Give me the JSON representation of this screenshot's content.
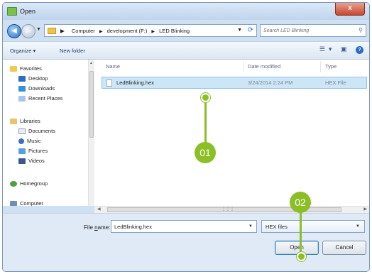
{
  "window": {
    "title": "Open",
    "close_label": "x"
  },
  "address": {
    "crumbs": [
      "Computer",
      "development (F:)",
      "LED Blinking"
    ],
    "search_placeholder": "Search LED Blinking"
  },
  "toolbar": {
    "organize": "Organize ▾",
    "new_folder": "New folder"
  },
  "nav": {
    "favorites": "Favorites",
    "desktop": "Desktop",
    "downloads": "Downloads",
    "recent": "Recent Places",
    "libraries": "Libraries",
    "documents": "Documents",
    "music": "Music",
    "pictures": "Pictures",
    "videos": "Videos",
    "homegroup": "Homegroup",
    "computer": "Computer"
  },
  "columns": {
    "name": "Name",
    "date": "Date modified",
    "type": "Type"
  },
  "files": [
    {
      "name": "LedBlinking.hex",
      "date": "3/24/2014 2:24 PM",
      "type": "HEX File"
    }
  ],
  "bottom": {
    "filename_label_pre": "File ",
    "filename_label_u": "n",
    "filename_label_post": "ame:",
    "filename_value": "LedBlinking.hex",
    "filetype": "HEX files",
    "open": "Open",
    "cancel": "Cancel"
  },
  "annotations": {
    "step1": "01",
    "step2": "02"
  },
  "colors": {
    "accent": "#8cbf26",
    "selection": "#cde6f7"
  }
}
